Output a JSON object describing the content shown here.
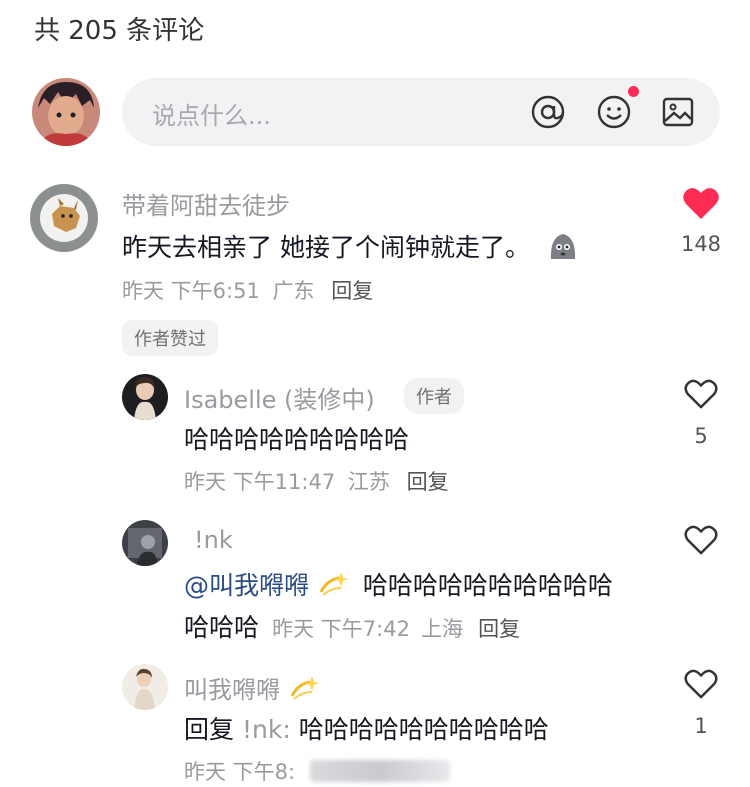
{
  "header": {
    "comment_count": "共 205 条评论"
  },
  "input": {
    "placeholder": "说点什么..."
  },
  "comment": {
    "username": "带着阿甜去徒步",
    "text": "昨天去相亲了 她接了个闹钟就走了。",
    "time": "昨天 下午6:51",
    "location": "广东",
    "reply_label": "回复",
    "likes": "148",
    "author_liked_badge": "作者赞过"
  },
  "replies": [
    {
      "username": "Isabelle (装修中)",
      "author_badge": "作者",
      "text": "哈哈哈哈哈哈哈哈哈",
      "time": "昨天 下午11:47",
      "location": "江苏",
      "reply_label": "回复",
      "likes": "5"
    },
    {
      "username": "!nk",
      "mention": "@叫我嘚嘚",
      "text_line1": "哈哈哈哈哈哈哈哈哈哈",
      "text_line2": "哈哈哈",
      "time": "昨天 下午7:42",
      "location": "上海",
      "reply_label": "回复",
      "likes": ""
    },
    {
      "username": "叫我嘚嘚",
      "reply_prefix": "回复",
      "reply_target": "!nk:",
      "text": "哈哈哈哈哈哈哈哈哈哈",
      "time": "昨天 下午8:",
      "likes": "1"
    }
  ],
  "icons": {
    "heart_active_color": "#fe2c55",
    "notification_dot_color": "#fe2c55",
    "at": "at-icon",
    "emoji": "emoji-icon",
    "image": "image-icon"
  }
}
